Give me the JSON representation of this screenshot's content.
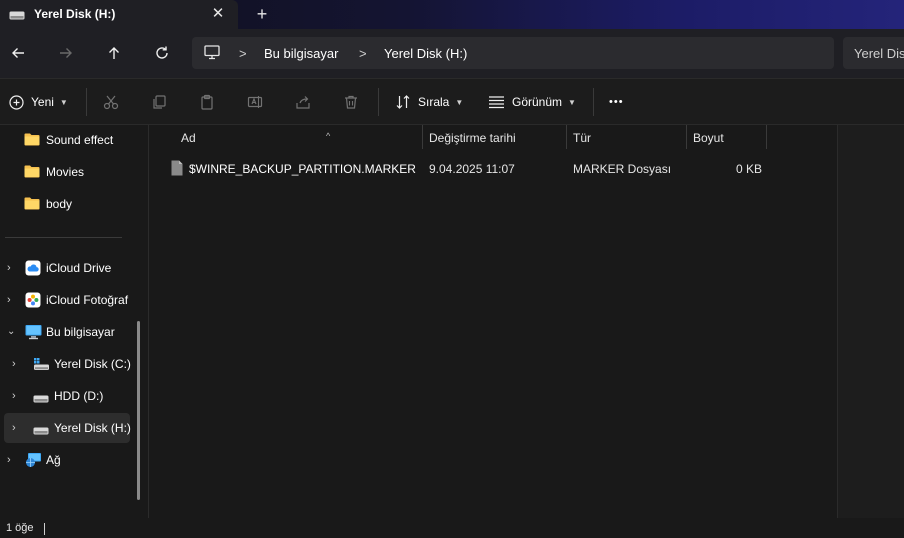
{
  "tab": {
    "title": "Yerel Disk (H:)",
    "close": "✕",
    "new_tab": "+"
  },
  "address": {
    "crumbs": [
      "Bu bilgisayar",
      "Yerel Disk (H:)"
    ],
    "chevron": ">"
  },
  "search": {
    "placeholder": "Yerel Dis"
  },
  "toolbar": {
    "new_label": "Yeni",
    "sort_label": "Sırala",
    "view_label": "Görünüm",
    "more_label": "•••"
  },
  "sidebar": {
    "items": [
      {
        "label": "Sound effect",
        "icon": "folder-icon"
      },
      {
        "label": "Movies",
        "icon": "folder-icon"
      },
      {
        "label": "body",
        "icon": "folder-icon"
      },
      {
        "label": "iCloud Drive",
        "icon": "icloud-drive-icon"
      },
      {
        "label": "iCloud Fotoğraf",
        "icon": "icloud-photos-icon"
      },
      {
        "label": "Bu bilgisayar",
        "icon": "computer-icon"
      },
      {
        "label": "Yerel Disk (C:)",
        "icon": "system-drive-icon"
      },
      {
        "label": "HDD (D:)",
        "icon": "drive-icon"
      },
      {
        "label": "Yerel Disk (H:)",
        "icon": "drive-icon"
      },
      {
        "label": "Ağ",
        "icon": "network-icon"
      }
    ]
  },
  "columns": [
    "Ad",
    "Değiştirme tarihi",
    "Tür",
    "Boyut"
  ],
  "files": [
    {
      "name": "$WINRE_BACKUP_PARTITION.MARKER",
      "modified": "9.04.2025 11:07",
      "type": "MARKER Dosyası",
      "size": "0 KB"
    }
  ],
  "status": {
    "count": "1 öğe"
  },
  "colors": {
    "accent": "#4cc2ff",
    "folder": "#f5c04f",
    "background": "#191919"
  }
}
